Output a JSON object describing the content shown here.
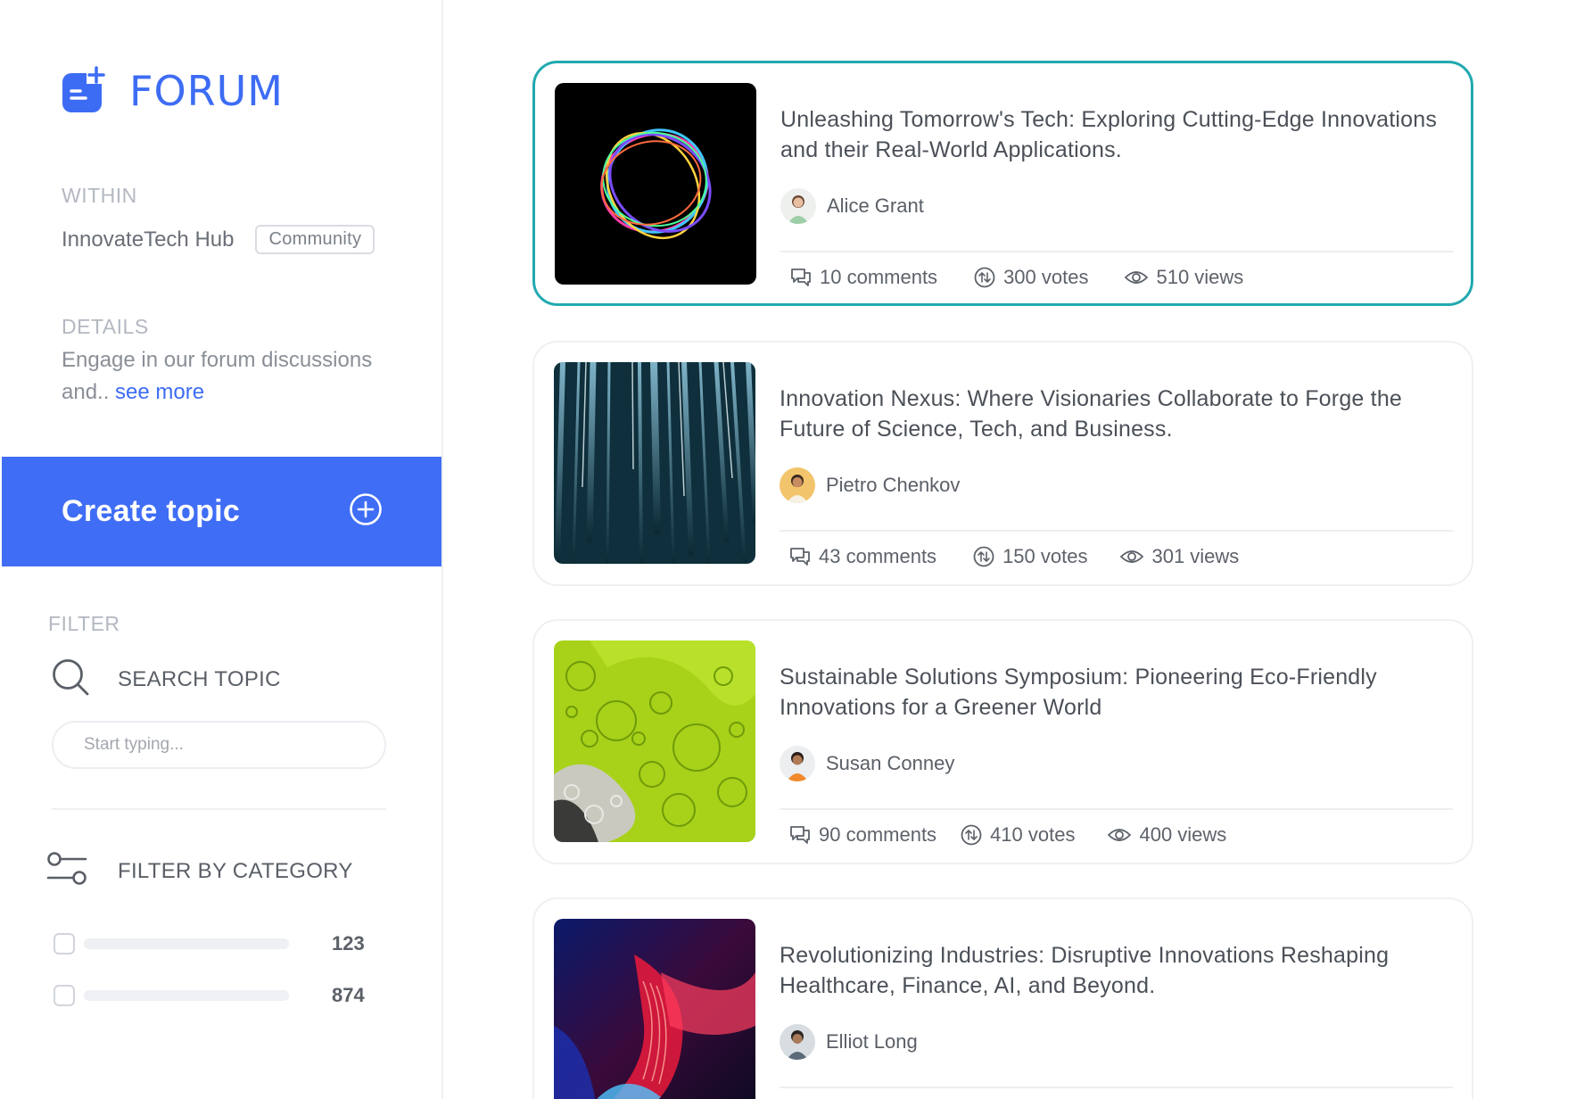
{
  "app": {
    "title": "FORUM",
    "logo_icon": "forum-add-icon",
    "accent_color": "#3d6cf4"
  },
  "within": {
    "label": "WITHIN",
    "hub_name": "InnovateTech Hub",
    "badge": "Community"
  },
  "details": {
    "label": "DETAILS",
    "text": "Engage in our forum discussions and.. ",
    "link": "see more"
  },
  "create_topic": {
    "label": "Create topic",
    "icon": "plus-circle-icon",
    "color": "#3f6df5"
  },
  "filter": {
    "label": "FILTER",
    "search_label": "SEARCH TOPIC",
    "search_placeholder": "Start typing...",
    "category_label": "FILTER BY CATEGORY",
    "categories": [
      {
        "count": "123"
      },
      {
        "count": "874"
      }
    ]
  },
  "topics": [
    {
      "title": "Unleashing Tomorrow's Tech: Exploring Cutting-Edge Innovations and their Real-World Applications.",
      "author": "Alice Grant",
      "comments": "10 comments",
      "votes": "300 votes",
      "views": "510 views",
      "active": true
    },
    {
      "title": "Innovation Nexus: Where Visionaries Collaborate to Forge the Future of Science, Tech, and Business.",
      "author": "Pietro Chenkov",
      "comments": "43 comments",
      "votes": "150 votes",
      "views": "301 views"
    },
    {
      "title": "Sustainable Solutions Symposium: Pioneering Eco-Friendly Innovations for a Greener World",
      "author": "Susan Conney",
      "comments": "90 comments",
      "votes": "410 votes",
      "views": "400 views"
    },
    {
      "title": "Revolutionizing Industries: Disruptive Innovations Reshaping Healthcare, Finance, AI, and Beyond.",
      "author": "Elliot Long"
    }
  ],
  "colors": {
    "active_border": "#21a9b0",
    "card_border": "#eff0f3"
  }
}
